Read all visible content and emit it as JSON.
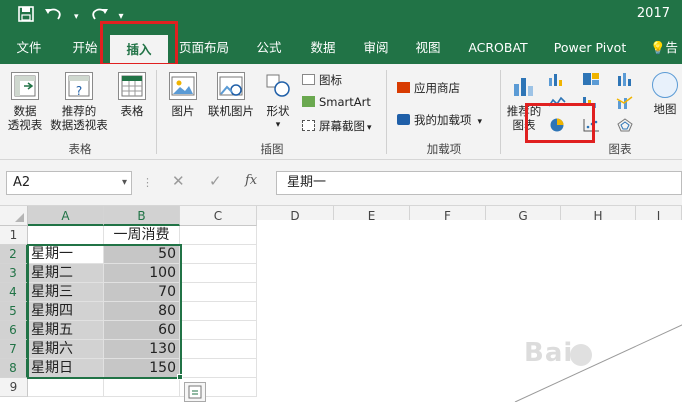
{
  "title_bar": {
    "year_text": "2017"
  },
  "tabs": [
    {
      "label": "文件"
    },
    {
      "label": "开始"
    },
    {
      "label": "插入"
    },
    {
      "label": "页面布局"
    },
    {
      "label": "公式"
    },
    {
      "label": "数据"
    },
    {
      "label": "审阅"
    },
    {
      "label": "视图"
    },
    {
      "label": "ACROBAT"
    },
    {
      "label": "Power Pivot"
    },
    {
      "label": "告"
    }
  ],
  "ribbon": {
    "tables_group": {
      "label": "表格",
      "pivot_line1": "数据",
      "pivot_line2": "透视表",
      "recommended_line1": "推荐的",
      "recommended_line2": "数据透视表",
      "table": "表格"
    },
    "illustrations_group": {
      "label": "插图",
      "pictures": "图片",
      "online_pictures": "联机图片",
      "shapes": "形状",
      "icons": "图标",
      "smartart": "SmartArt",
      "screenshot": "屏幕截图"
    },
    "addins_group": {
      "label": "加载项",
      "store": "应用商店",
      "my_addins": "我的加载项"
    },
    "charts_group": {
      "label": "图表",
      "recommended_line1": "推荐的",
      "recommended_line2": "图表",
      "map": "地图"
    }
  },
  "formula_bar": {
    "name_box": "A2",
    "fx": "fx",
    "content": "星期一"
  },
  "columns": [
    "A",
    "B",
    "C",
    "D",
    "E",
    "F",
    "G",
    "H",
    "I"
  ],
  "rows": [
    "1",
    "2",
    "3",
    "4",
    "5",
    "6",
    "7",
    "8",
    "9"
  ],
  "sheet": {
    "header_b1": "一周消费",
    "data": [
      {
        "day": "星期一",
        "value": "50"
      },
      {
        "day": "星期二",
        "value": "100"
      },
      {
        "day": "星期三",
        "value": "70"
      },
      {
        "day": "星期四",
        "value": "80"
      },
      {
        "day": "星期五",
        "value": "60"
      },
      {
        "day": "星期六",
        "value": "130"
      },
      {
        "day": "星期日",
        "value": "150"
      }
    ]
  },
  "watermark": {
    "text": "Bai"
  },
  "colors": {
    "excel_green": "#217346",
    "highlight_red": "#e02020",
    "selection_gray": "#c6c6c6"
  }
}
